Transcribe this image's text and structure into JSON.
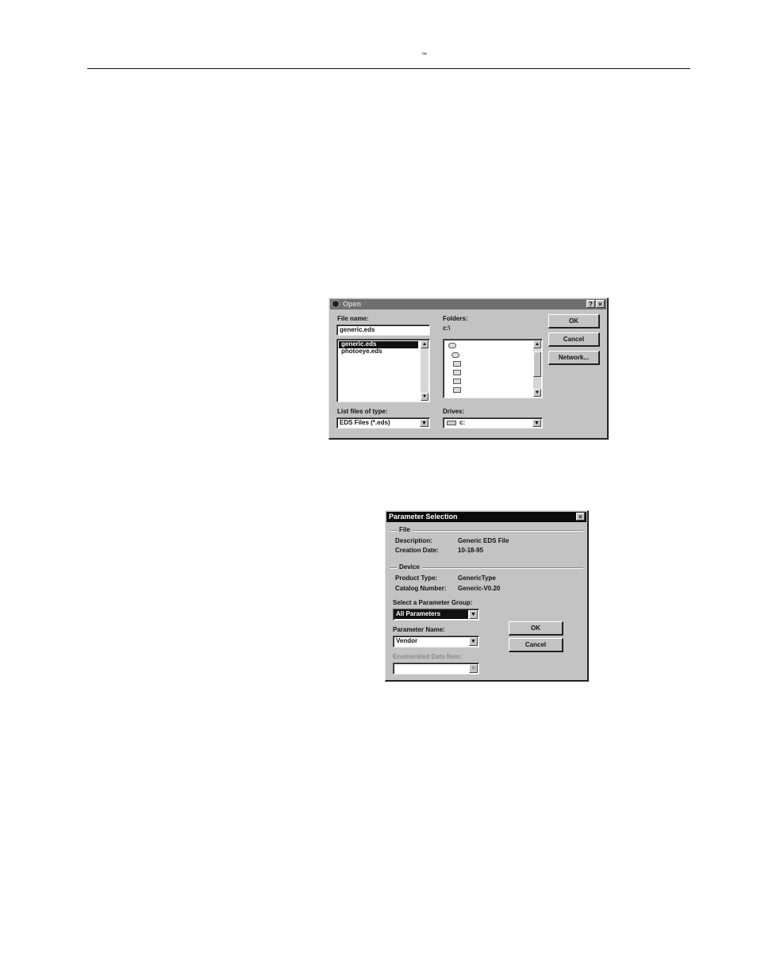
{
  "header": {
    "trademark": "™"
  },
  "open_dialog": {
    "title": "Open",
    "help_glyph": "?",
    "close_glyph": "×",
    "file_name_label": "File name:",
    "file_name_value": "generic.eds",
    "files": [
      "generic.eds",
      "photoeye.eds"
    ],
    "folders_label": "Folders:",
    "current_path": "c:\\",
    "list_type_label": "List files of type:",
    "list_type_value": "EDS Files (*.eds)",
    "drives_label": "Drives:",
    "drive_value": "c:",
    "ok_label": "OK",
    "cancel_label": "Cancel",
    "network_label": "Network..."
  },
  "param_dialog": {
    "title": "Parameter Selection",
    "close_glyph": "×",
    "file_group": "File",
    "description_label": "Description:",
    "description_value": "Generic EDS File",
    "creation_label": "Creation Date:",
    "creation_value": "10-18-95",
    "device_group": "Device",
    "product_type_label": "Product Type:",
    "product_type_value": "GenericType",
    "catalog_label": "Catalog Number:",
    "catalog_value": "Generic-V0.20",
    "group_label": "Select a Parameter Group:",
    "group_value": "All Parameters",
    "param_name_label": "Parameter Name:",
    "param_name_value": "Vendor",
    "enum_label": "Enumerated Data Item:",
    "enum_value": "",
    "ok_label": "OK",
    "cancel_label": "Cancel"
  },
  "colors": {
    "dialog_face": "#c3c3c3",
    "open_titlebar": "#6f6f6f",
    "param_titlebar": "#0a0a0a",
    "selection": "#111111"
  },
  "icons": {
    "app": "globe-icon",
    "folder": "folder-icon",
    "drive": "drive-icon",
    "dropdown": "chevron-down-icon",
    "scroll_up": "arrow-up-icon",
    "scroll_down": "arrow-down-icon"
  }
}
